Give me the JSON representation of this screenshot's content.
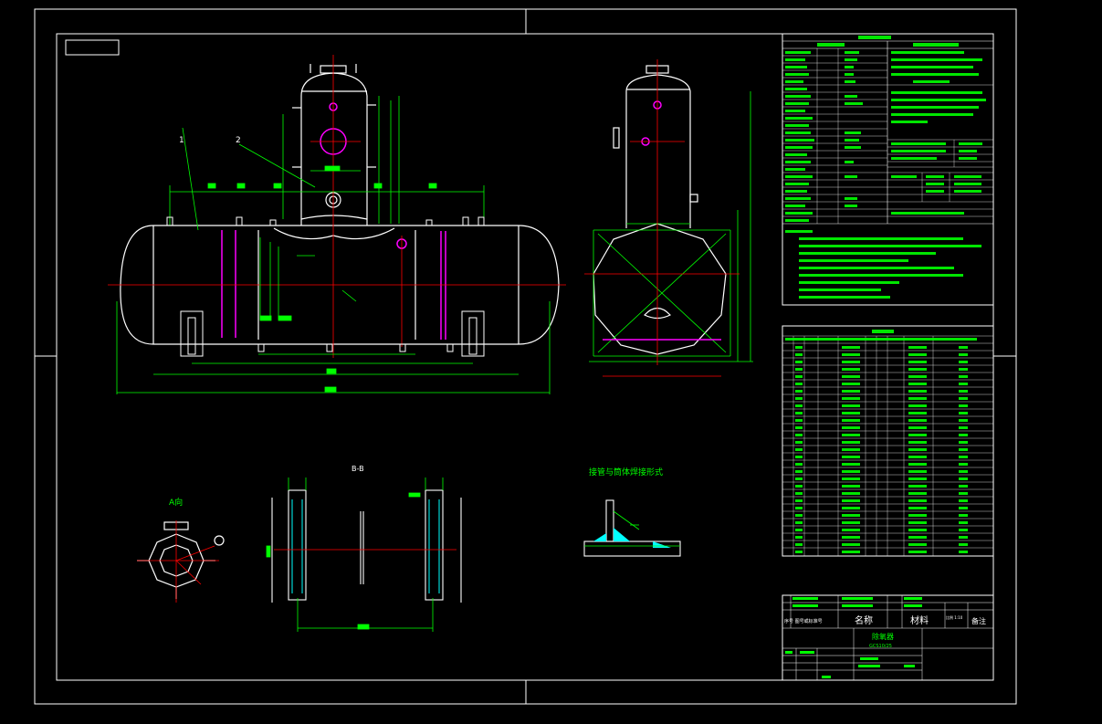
{
  "colors": {
    "background": "#000000",
    "frame": "#ffffff",
    "vessel": "#ffffff",
    "dimension": "#00ff00",
    "centerline": "#ff0000",
    "nozzle_pink": "#ff00ff",
    "weld_cyan": "#00ffff",
    "accent_yellow": "#ffff00"
  },
  "labels": {
    "part_1": "1",
    "part_2": "2",
    "view_a": "A向",
    "section_bb": "B-B",
    "weld_title": "接管与筒体焊接形式"
  },
  "title_block": {
    "header_name": "名称",
    "header_material": "材料",
    "header_note": "备注",
    "header_scale": "比例 1:10",
    "header_seq": "序号 图号或标准号",
    "drawing_name": "除氧器",
    "drawing_no": "GCS10/25"
  }
}
